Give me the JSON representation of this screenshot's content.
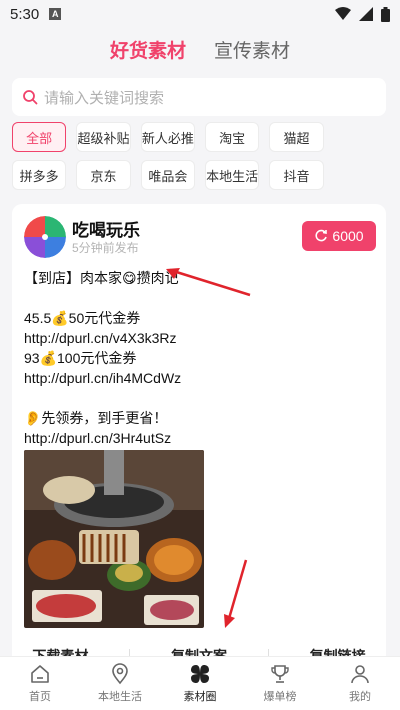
{
  "status": {
    "time": "5:30",
    "notification": "A"
  },
  "tabs": [
    {
      "label": "好货素材",
      "active": true
    },
    {
      "label": "宣传素材",
      "active": false
    }
  ],
  "search": {
    "placeholder": "请输入关键词搜索"
  },
  "categories": [
    "全部",
    "超级补贴",
    "新人必推",
    "淘宝",
    "猫超",
    "拼多多",
    "京东",
    "唯品会",
    "本地生活",
    "抖音"
  ],
  "post": {
    "shop_name": "吃喝玩乐",
    "time_ago": "5分钟前发布",
    "count": "6000",
    "lines": [
      "【到店】肉本家😋攒肉记",
      "",
      "45.5💰50元代金券",
      "http://dpurl.cn/v4X3k3Rz",
      "93💰100元代金券",
      "http://dpurl.cn/ih4MCdWz",
      "",
      "👂先领券，到手更省！",
      "http://dpurl.cn/3Hr4utSz"
    ],
    "actions": [
      "下载素材",
      "复制文案",
      "复制链接"
    ]
  },
  "nav": [
    {
      "label": "首页",
      "icon": "home-icon",
      "active": false
    },
    {
      "label": "本地生活",
      "icon": "location-icon",
      "active": false
    },
    {
      "label": "素材圈",
      "icon": "clover-icon",
      "active": true
    },
    {
      "label": "爆单榜",
      "icon": "trophy-icon",
      "active": false
    },
    {
      "label": "我的",
      "icon": "profile-icon",
      "active": false
    }
  ],
  "colors": {
    "accent": "#f0426b",
    "background": "#f5f5f7",
    "annotation": "#e0242c"
  }
}
